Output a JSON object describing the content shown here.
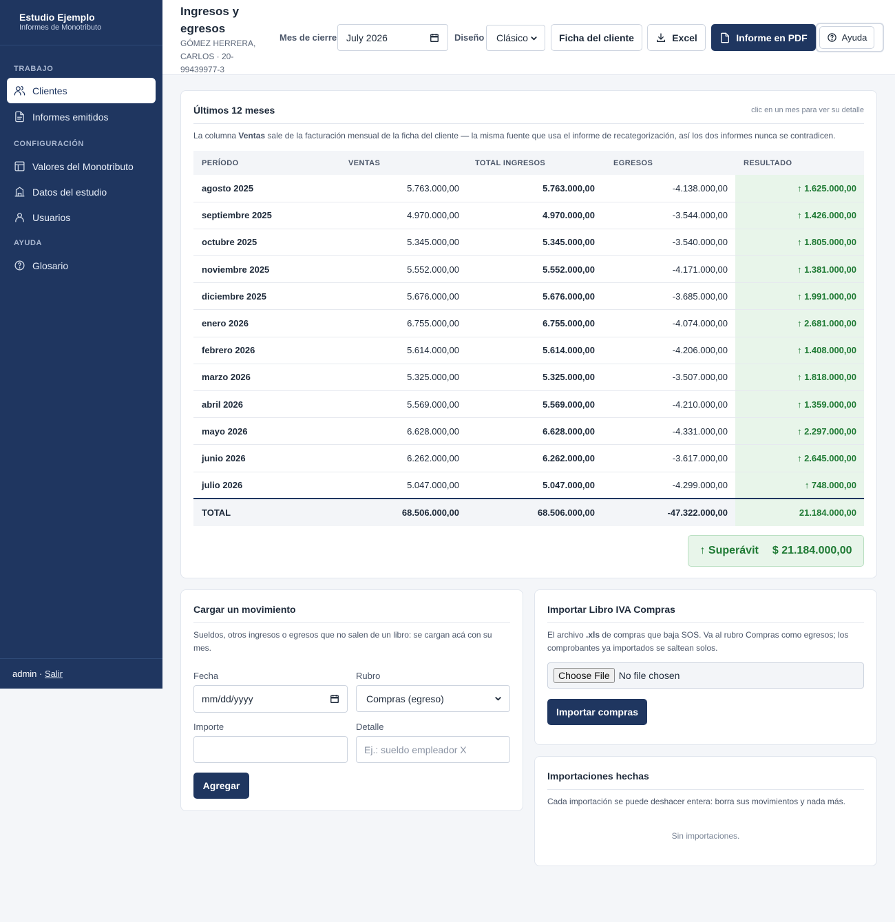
{
  "sidebar": {
    "brand_title": "Estudio Ejemplo",
    "brand_sub": "Informes de Monotributo",
    "sections": [
      {
        "label": "Trabajo"
      },
      {
        "label": "Configuración"
      },
      {
        "label": "Ayuda"
      }
    ],
    "items": {
      "clientes": "Clientes",
      "informes": "Informes emitidos",
      "valores": "Valores del Monotributo",
      "datos": "Datos del estudio",
      "usuarios": "Usuarios",
      "glosario": "Glosario"
    },
    "user": "admin · ",
    "logout": "Salir"
  },
  "header": {
    "title": "Ingresos y egresos",
    "client": "GÓMEZ HERRERA, CARLOS · 20-99439977-3",
    "month_label": "Mes de cierre",
    "month_value": "July 2026",
    "design_label": "Diseño",
    "design_value": "Clásico",
    "ficha": "Ficha del cliente",
    "excel": "Excel",
    "pdf": "Informe en PDF",
    "help": "Ayuda"
  },
  "report": {
    "title": "Últimos 12 meses",
    "hint": "clic en un mes para ver su detalle",
    "desc_pre": "La columna ",
    "desc_bold": "Ventas",
    "desc_post": " sale de la facturación mensual de la ficha del cliente — la misma fuente que usa el informe de recategorización, así los dos informes nunca se contradicen.",
    "columns": [
      "Período",
      "Ventas",
      "Total ingresos",
      "Egresos",
      "Resultado"
    ],
    "rows": [
      {
        "period": "agosto 2025",
        "ventas": "5.763.000,00",
        "total": "5.763.000,00",
        "egresos": "-4.138.000,00",
        "resultado": "↑ 1.625.000,00"
      },
      {
        "period": "septiembre 2025",
        "ventas": "4.970.000,00",
        "total": "4.970.000,00",
        "egresos": "-3.544.000,00",
        "resultado": "↑ 1.426.000,00"
      },
      {
        "period": "octubre 2025",
        "ventas": "5.345.000,00",
        "total": "5.345.000,00",
        "egresos": "-3.540.000,00",
        "resultado": "↑ 1.805.000,00"
      },
      {
        "period": "noviembre 2025",
        "ventas": "5.552.000,00",
        "total": "5.552.000,00",
        "egresos": "-4.171.000,00",
        "resultado": "↑ 1.381.000,00"
      },
      {
        "period": "diciembre 2025",
        "ventas": "5.676.000,00",
        "total": "5.676.000,00",
        "egresos": "-3.685.000,00",
        "resultado": "↑ 1.991.000,00"
      },
      {
        "period": "enero 2026",
        "ventas": "6.755.000,00",
        "total": "6.755.000,00",
        "egresos": "-4.074.000,00",
        "resultado": "↑ 2.681.000,00"
      },
      {
        "period": "febrero 2026",
        "ventas": "5.614.000,00",
        "total": "5.614.000,00",
        "egresos": "-4.206.000,00",
        "resultado": "↑ 1.408.000,00"
      },
      {
        "period": "marzo 2026",
        "ventas": "5.325.000,00",
        "total": "5.325.000,00",
        "egresos": "-3.507.000,00",
        "resultado": "↑ 1.818.000,00"
      },
      {
        "period": "abril 2026",
        "ventas": "5.569.000,00",
        "total": "5.569.000,00",
        "egresos": "-4.210.000,00",
        "resultado": "↑ 1.359.000,00"
      },
      {
        "period": "mayo 2026",
        "ventas": "6.628.000,00",
        "total": "6.628.000,00",
        "egresos": "-4.331.000,00",
        "resultado": "↑ 2.297.000,00"
      },
      {
        "period": "junio 2026",
        "ventas": "6.262.000,00",
        "total": "6.262.000,00",
        "egresos": "-3.617.000,00",
        "resultado": "↑ 2.645.000,00"
      },
      {
        "period": "julio 2026",
        "ventas": "5.047.000,00",
        "total": "5.047.000,00",
        "egresos": "-4.299.000,00",
        "resultado": "↑ 748.000,00"
      }
    ],
    "total": {
      "label": "TOTAL",
      "ventas": "68.506.000,00",
      "total": "68.506.000,00",
      "egresos": "-47.322.000,00",
      "resultado": "21.184.000,00"
    },
    "surplus_label": "↑ Superávit",
    "surplus_value": "$ 21.184.000,00"
  },
  "movement": {
    "title": "Cargar un movimiento",
    "desc": "Sueldos, otros ingresos o egresos que no salen de un libro: se cargan acá con su mes.",
    "fecha_label": "Fecha",
    "fecha_placeholder": "mm/dd/yyyy",
    "rubro_label": "Rubro",
    "rubro_value": "Compras (egreso)",
    "importe_label": "Importe",
    "importe_value": "",
    "detalle_label": "Detalle",
    "detalle_placeholder": "Ej.: sueldo empleador X",
    "submit": "Agregar"
  },
  "import_iva": {
    "title": "Importar Libro IVA Compras",
    "desc_pre": "El archivo ",
    "desc_bold": ".xls",
    "desc_post": " de compras que baja SOS. Va al rubro Compras como egresos; los comprobantes ya importados se saltean solos.",
    "file_button": "Choose File",
    "file_status": "No file chosen",
    "submit": "Importar compras"
  },
  "imports_done": {
    "title": "Importaciones hechas",
    "desc": "Cada importación se puede deshacer entera: borra sus movimientos y nada más.",
    "empty": "Sin importaciones."
  }
}
